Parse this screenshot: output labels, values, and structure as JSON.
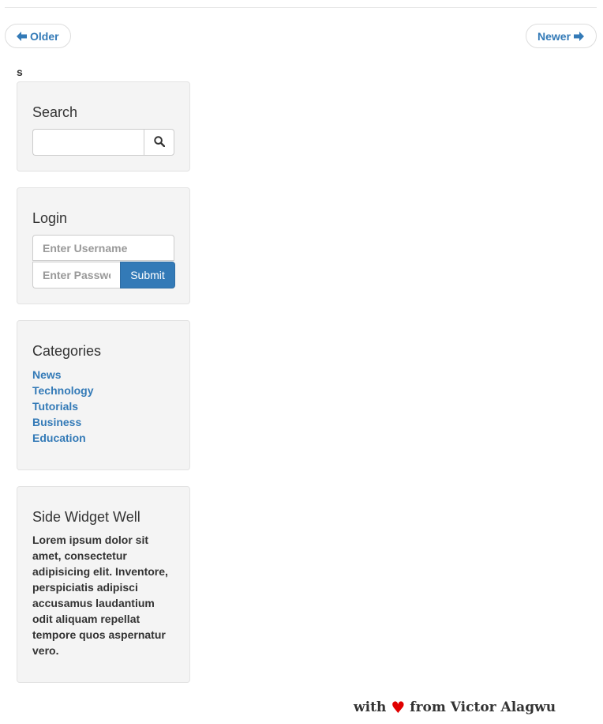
{
  "pager": {
    "older_label": "Older",
    "newer_label": "Newer"
  },
  "stray_text": "s",
  "search_widget": {
    "title": "Search",
    "input_value": "",
    "icon": "search-icon"
  },
  "login_widget": {
    "title": "Login",
    "username_placeholder": "Enter Username",
    "password_placeholder": "Enter Password",
    "submit_label": "Submit"
  },
  "categories_widget": {
    "title": "Categories",
    "items": [
      "News",
      "Technology",
      "Tutorials",
      "Business",
      "Education"
    ]
  },
  "side_widget": {
    "title": "Side Widget Well",
    "body": "Lorem ipsum dolor sit amet, consectetur adipisicing elit. Inventore, perspiciatis adipisci accusamus laudantium odit aliquam repellat tempore quos aspernatur vero."
  },
  "footer": {
    "prefix": "with",
    "heart": "♥",
    "suffix": "from Victor Alagwu"
  },
  "colors": {
    "link": "#337ab7",
    "primary_button": "#337ab7",
    "well_background": "#f4f4f4",
    "heart": "#e00000"
  }
}
